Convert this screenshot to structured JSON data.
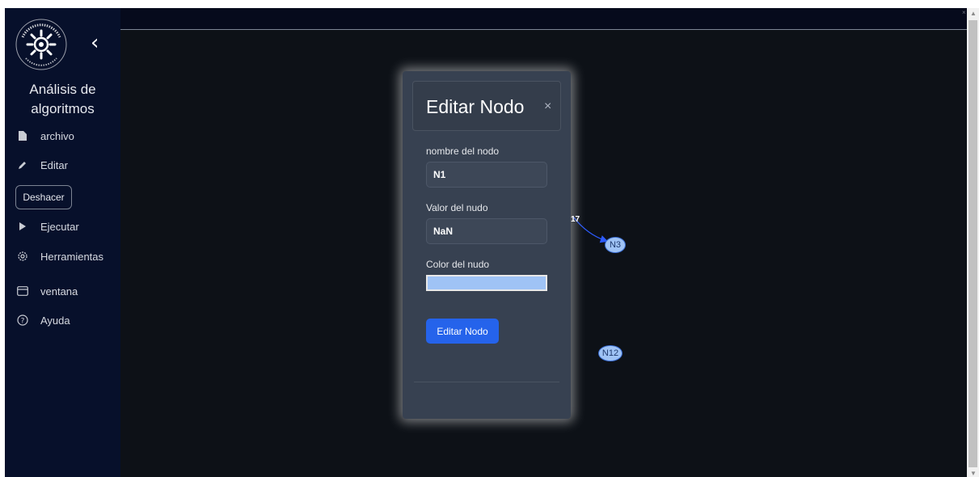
{
  "app": {
    "title": "Análisis de algoritmos",
    "collapse_icon": "chevron-left-icon"
  },
  "sidebar": {
    "items": [
      {
        "label": "archivo",
        "icon": "file-icon"
      },
      {
        "label": "Editar",
        "icon": "pencil-icon"
      },
      {
        "label": "Deshacer",
        "icon": ""
      },
      {
        "label": "Ejecutar",
        "icon": "play-icon"
      },
      {
        "label": "Herramientas",
        "icon": "gear-icon"
      },
      {
        "label": "ventana",
        "icon": "window-icon"
      },
      {
        "label": "Ayuda",
        "icon": "help-icon"
      }
    ]
  },
  "modal": {
    "title": "Editar Nodo",
    "close_label": "×",
    "name_label": "nombre del nodo",
    "name_value": "N1",
    "value_label": "Valor del nudo",
    "value_value": "NaN",
    "color_label": "Color del nudo",
    "color_value": "#9fc3f5",
    "submit_label": "Editar Nodo"
  },
  "graph": {
    "nodes": [
      {
        "label": "N3"
      },
      {
        "label": "N12"
      }
    ],
    "edge_label": "17",
    "node_color": "#9fc3f5",
    "edge_color": "#2c5bff"
  },
  "colors": {
    "sidebar_bg": "#07102b",
    "canvas_bg": "#0d1117",
    "modal_bg": "#374151",
    "accent": "#2563eb"
  }
}
